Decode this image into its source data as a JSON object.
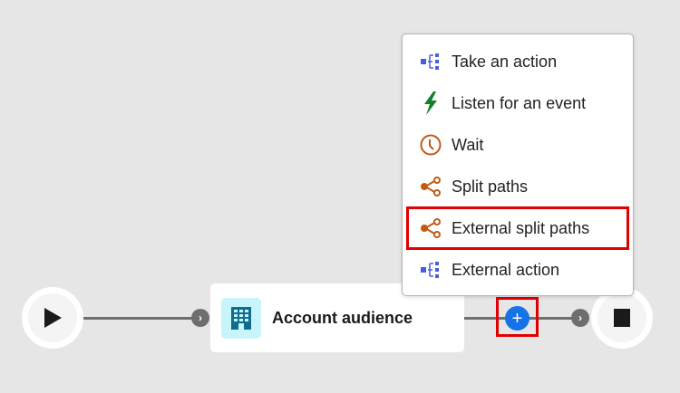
{
  "canvas": {
    "start_node": {
      "icon": "play-icon"
    },
    "audience_card": {
      "title": "Account audience",
      "icon": "building-icon"
    },
    "add_button": {
      "label": "+",
      "icon": "plus-icon"
    },
    "end_node": {
      "icon": "stop-icon"
    }
  },
  "menu": {
    "items": [
      {
        "label": "Take an action",
        "icon": "action-icon",
        "color": "#4b5cdc"
      },
      {
        "label": "Listen for an event",
        "icon": "lightning-icon",
        "color": "#12802b"
      },
      {
        "label": "Wait",
        "icon": "clock-icon",
        "color": "#c05a14"
      },
      {
        "label": "Split paths",
        "icon": "split-icon",
        "color": "#c05a14"
      },
      {
        "label": "External split paths",
        "icon": "split-icon",
        "color": "#c05a14",
        "highlighted": true
      },
      {
        "label": "External action",
        "icon": "action-icon",
        "color": "#4b5cdc"
      }
    ]
  },
  "colors": {
    "highlight": "#e10000",
    "accent": "#1473e6"
  }
}
